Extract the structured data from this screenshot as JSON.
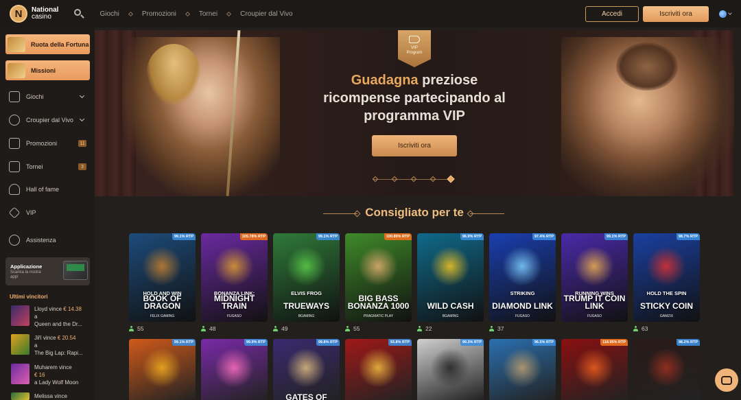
{
  "brand": {
    "name": "National",
    "sub": "casino",
    "mark": "N"
  },
  "nav": {
    "items": [
      "Giochi",
      "Promozioni",
      "Tornei",
      "Croupier dal Vivo"
    ]
  },
  "auth": {
    "login": "Accedi",
    "signup": "Iscriviti ora"
  },
  "sidebar": {
    "promos": [
      {
        "label": "Ruota della Fortuna"
      },
      {
        "label": "Missioni"
      }
    ],
    "items": [
      {
        "label": "Giochi",
        "icon": "games-icon",
        "chevron": true
      },
      {
        "label": "Croupier dal Vivo",
        "icon": "live-dealer-icon",
        "chevron": true
      },
      {
        "label": "Promozioni",
        "icon": "megaphone-icon",
        "badge": "11"
      },
      {
        "label": "Tornei",
        "icon": "tournament-icon",
        "badge": "3"
      },
      {
        "label": "Hall of fame",
        "icon": "laurel-icon"
      },
      {
        "label": "VIP",
        "icon": "diamond-icon"
      },
      {
        "label": "Assistenza",
        "icon": "help-icon"
      }
    ],
    "app": {
      "title": "Applicazione",
      "subtitle": "Scarica la nostra app!"
    },
    "winners_title": "Ultimi vincitori",
    "winners": [
      {
        "line1": "Lloyd vince",
        "amount": "€ 14.38",
        "line2": "a",
        "game": "Queen and the Dr..."
      },
      {
        "line1": "Jiří vince",
        "amount": "€ 20.54",
        "line2": "a",
        "game": "The Big Lap: Rapi..."
      },
      {
        "line1": "Muharem vince",
        "amount": "€ 16",
        "line2": "a",
        "game": "Lady Wolf Moon"
      },
      {
        "line1": "Melissa vince",
        "amount": "",
        "line2": "",
        "game": ""
      }
    ]
  },
  "hero": {
    "badge_line1": "VIP",
    "badge_line2": "Program",
    "title_gold": "Guadagna",
    "title_rest1": " preziose",
    "title_line2": "ricompense partecipando al",
    "title_line3": "programma VIP",
    "cta": "Iscriviti ora",
    "slides": 5,
    "active_slide": 4
  },
  "section": {
    "title": "Consigliato per te"
  },
  "games_row1": [
    {
      "rtp": "99.1% RTP",
      "hot": false,
      "name": "BOOK OF DRAGON",
      "sub": "HOLD AND WIN",
      "provider": "FELIX GAMING",
      "players": "55",
      "bg": "#1d4b7a",
      "art": "#c9822f"
    },
    {
      "rtp": "105.78% RTP",
      "hot": true,
      "name": "MIDNIGHT TRAIN",
      "sub": "BONANZA LINK:",
      "provider": "FUGASO",
      "players": "48",
      "bg": "#6a2aa0",
      "art": "#e0a030"
    },
    {
      "rtp": "99.1% RTP",
      "hot": false,
      "name": "TRUEWAYS",
      "sub": "ELVIS FROG",
      "provider": "BGAMING",
      "players": "49",
      "bg": "#2f7a3a",
      "art": "#5ccf4a"
    },
    {
      "rtp": "100.89% RTP",
      "hot": true,
      "name": "BIG BASS BONANZA 1000",
      "sub": "",
      "provider": "PRAGMATIC PLAY",
      "players": "55",
      "bg": "#3f8a2a",
      "art": "#e8b070"
    },
    {
      "rtp": "96.9% RTP",
      "hot": false,
      "name": "WILD CASH",
      "sub": "",
      "provider": "BGAMING",
      "players": "22",
      "bg": "#0f6a8a",
      "art": "#f5c820"
    },
    {
      "rtp": "97.4% RTP",
      "hot": false,
      "name": "DIAMOND LINK",
      "sub": "STRIKING",
      "provider": "FUGASO",
      "players": "37",
      "bg": "#1a3fb0",
      "art": "#7fd0ff"
    },
    {
      "rtp": "99.1% RTP",
      "hot": false,
      "name": "TRUMP IT COIN LINK",
      "sub": "RUNNING WINS",
      "provider": "FUGASO",
      "players": "",
      "bg": "#4a2aa8",
      "art": "#f0b050"
    },
    {
      "rtp": "98.7% RTP",
      "hot": false,
      "name": "STICKY COIN",
      "sub": "HOLD THE SPIN",
      "provider": "GAMZIX",
      "players": "63",
      "bg": "#1a40a0",
      "art": "#e03030"
    }
  ],
  "games_row2": [
    {
      "rtp": "99.1% RTP",
      "hot": false,
      "bg": "#d05a1a",
      "art": "#f5b020"
    },
    {
      "rtp": "99.9% RTP",
      "hot": false,
      "bg": "#7a2aa8",
      "art": "#ff70c0"
    },
    {
      "rtp": "99.8% RTP",
      "hot": false,
      "bg": "#3a2a70",
      "art": "#e0c080"
    },
    {
      "rtp": "93.8% RTP",
      "hot": false,
      "bg": "#a01818",
      "art": "#f5c040"
    },
    {
      "rtp": "99.3% RTP",
      "hot": false,
      "bg": "#cfcfcf",
      "art": "#222222"
    },
    {
      "rtp": "96.5% RTP",
      "hot": false,
      "bg": "#2a70b0",
      "art": "#c0a070"
    },
    {
      "rtp": "118.95% RTP",
      "hot": true,
      "bg": "#8a1010",
      "art": "#f06020"
    },
    {
      "rtp": "98.2% RTP",
      "hot": false,
      "bg": "#2a1a18",
      "art": "#a03020"
    }
  ],
  "row2_partial_title": "GATES OF"
}
